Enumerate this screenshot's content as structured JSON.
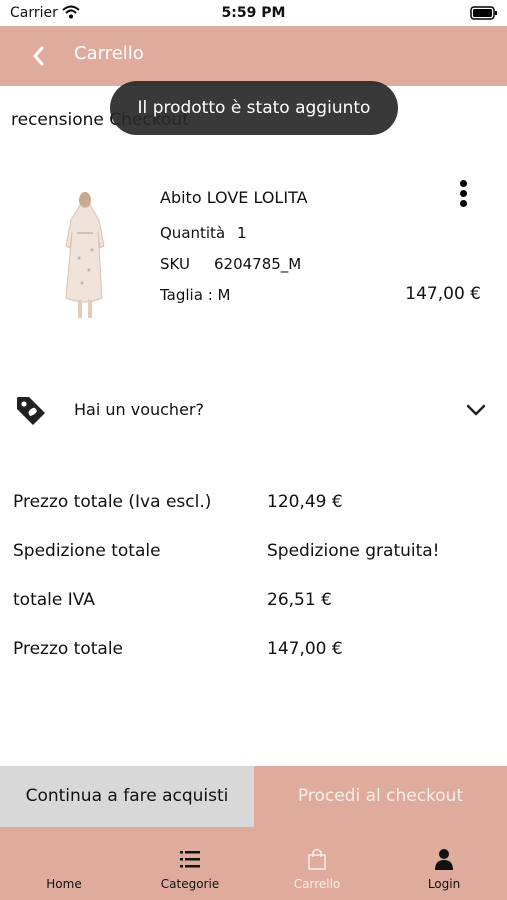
{
  "status": {
    "carrier": "Carrier",
    "time": "5:59 PM"
  },
  "nav": {
    "title": "Carrello"
  },
  "toast": {
    "message": "Il prodotto è stato aggiunto"
  },
  "section_title": "recensione Checkout",
  "product": {
    "name": "Abito LOVE LOLITA",
    "quantity_label": "Quantità",
    "quantity": "1",
    "sku_label": "SKU",
    "sku": "6204785_M",
    "size_text": "Taglia : M",
    "price": "147,00 €"
  },
  "voucher": {
    "label": "Hai un voucher?"
  },
  "summary": [
    {
      "label": "Prezzo totale (Iva escl.)",
      "value": "120,49 €"
    },
    {
      "label": "Spedizione totale",
      "value": "Spedizione gratuita!"
    },
    {
      "label": "totale IVA",
      "value": "26,51 €"
    },
    {
      "label": "Prezzo totale",
      "value": "147,00 €"
    }
  ],
  "buttons": {
    "continue": "Continua a fare acquisti",
    "checkout": "Procedi al checkout"
  },
  "tabs": [
    {
      "label": "Home",
      "icon": "home-icon"
    },
    {
      "label": "Categorie",
      "icon": "list-icon"
    },
    {
      "label": "Carrello",
      "icon": "bag-icon",
      "active": true
    },
    {
      "label": "Login",
      "icon": "user-icon"
    }
  ],
  "colors": {
    "accent": "#dfab9d",
    "secondary_button": "#d8d8d8",
    "active_tab": "#fbeeea"
  }
}
